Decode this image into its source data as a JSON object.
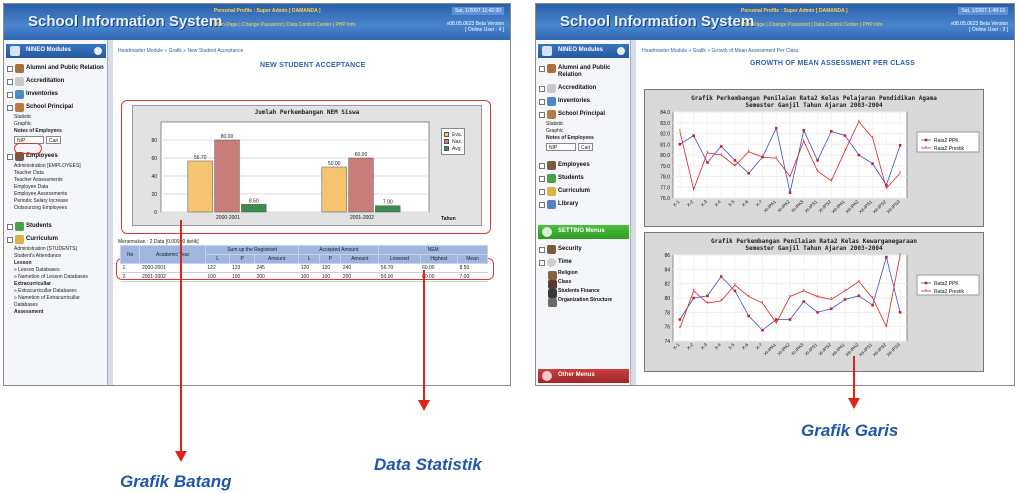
{
  "app": {
    "title": "School Information System",
    "profile": "Personal Profile : Super Admin [ DAMANDA ]",
    "links": "Main Page | Change Password | Data Control Center | PHP Info",
    "date1": "Sat, 1/2007 11:42:30",
    "date2": "Sat, 1/2007 1:49:16",
    "version": "v08.05.0623 Beta Version",
    "online": "[ Online User : 4 ]",
    "online2": "[ Online User : 3 ]"
  },
  "sidebar": {
    "modules_label": "NINEO Modules",
    "items1": [
      "Alumni and Public Relation",
      "Accreditation",
      "Inventories",
      "School Principal"
    ],
    "principal_sub": [
      "Statistic",
      "Graphic"
    ],
    "notes_label": "Notes of Employees",
    "search_value": "NIP",
    "search_btn": "Cari",
    "employees": "Employees",
    "employee_sub": [
      "Administration [EMPLOYEES]",
      "Teacher Data",
      "Teacher Assessments",
      "Employee Data",
      "Employee Assessments",
      "Periodic Salary Increase",
      "Outsourcing Employees"
    ],
    "students": "Students",
    "curriculum": "Curriculum",
    "curriculum_sub": [
      "Administration [STUDENTS]",
      "Student's Attendance",
      "Lesson",
      "» Lesson Databases",
      "» Nametion of Lesson Databases",
      "Extracurricullar",
      "» Extracurricullar Databases",
      "» Nametion of Extracurricullar Databases",
      "Assessment"
    ],
    "curriculum_bold": [
      "Lesson",
      "Extracurricullar",
      "Assessment"
    ],
    "library": "Library",
    "setting_label": "SETTING Menus",
    "setting_items": [
      "Security",
      "Time"
    ],
    "setting_sub": [
      "Religion",
      "Class",
      "Students Finance",
      "Organization Structure"
    ],
    "other_label": "Other Menus"
  },
  "left": {
    "breadcrumb": "Headmaster Module » Grafik » New Student Acceptance",
    "page_title": "NEW STUDENT ACCEPTANCE",
    "table_caption": "Menemukan : 2 Data [0,00990 detik]",
    "table_headers_top": [
      "No",
      "Academic Year",
      "Sum up the Registrant",
      "Accepted Amount",
      "NEM"
    ],
    "table_headers_sub": [
      "L",
      "P",
      "Amount",
      "L",
      "P",
      "Amount",
      "Lowered",
      "Highest",
      "Mean"
    ],
    "rows": [
      [
        "1.",
        "2000-2001",
        "122",
        "123",
        "245",
        "120",
        "120",
        "240",
        "56.70",
        "60.00",
        "8.50"
      ],
      [
        "2.",
        "2001-2002",
        "100",
        "100",
        "200",
        "100",
        "100",
        "200",
        "50.00",
        "60.00",
        "7.00"
      ]
    ]
  },
  "right": {
    "breadcrumb": "Headmaster Module » Grafik » Growth of Mean Assessment Per Class",
    "page_title": "GROWTH OF MEAN ASSESSMENT PER CLASS"
  },
  "captions": {
    "bar": "Grafik Batang",
    "stat": "Data Statistik",
    "line": "Grafik Garis"
  },
  "colors": {
    "eva": "#f5c470",
    "nax": "#c97d7b",
    "avg": "#3b8c4e",
    "blue": "#3a4fd6",
    "red": "#e02020"
  },
  "chart_data": [
    {
      "type": "bar",
      "title": "Jumlah Perkembangan NEM Siswa",
      "categories": [
        "2000-2001",
        "2001-2002"
      ],
      "xlabel": "Tahun",
      "ylim": [
        0,
        100
      ],
      "yticks": [
        "0",
        "20",
        "40",
        "60",
        "80"
      ],
      "series": [
        {
          "name": "Eva.",
          "values": [
            56.7,
            50.0
          ],
          "labels": [
            "56.70",
            "50.00"
          ]
        },
        {
          "name": "Nax.",
          "values": [
            80.0,
            60.0
          ],
          "labels": [
            "80.00",
            "60.00"
          ]
        },
        {
          "name": "Avg",
          "values": [
            8.5,
            7.0
          ],
          "labels": [
            "8.50",
            "7.00"
          ]
        }
      ]
    },
    {
      "type": "line",
      "title": "Grafik Perkembangan Penilaian Rata2 Kelas Pelajaran Pendidikan Agama",
      "subtitle": "Semester Ganjil Tahun Ajaran 2003-2004",
      "categories": [
        "X-1",
        "X-2",
        "X-3",
        "X-4",
        "X-5",
        "X-6",
        "X-7",
        "XI-IPA1",
        "XI-IPA2",
        "XI-IPA3",
        "XI-IPS1",
        "XI-IPS2",
        "XII-IPA1",
        "XII-IPA2",
        "XII-IPS1",
        "XII-IPS2",
        "XII-IPS3"
      ],
      "ylim": [
        76.0,
        84.0
      ],
      "yticks": [
        "76.0",
        "77.0",
        "78.0",
        "79.0",
        "80.0",
        "81.0",
        "82.0",
        "83.0",
        "84.0"
      ],
      "series": [
        {
          "name": "Rata2 PPK",
          "values": [
            81.0,
            81.8,
            79.3,
            80.8,
            79.5,
            78.3,
            79.8,
            82.5,
            76.5,
            82.3,
            79.5,
            82.2,
            81.8,
            80.0,
            79.2,
            77.2,
            80.9
          ]
        },
        {
          "name": "Rata2 Prestik",
          "values": [
            82.2,
            76.8,
            80.2,
            80.0,
            79.0,
            80.3,
            79.8,
            79.7,
            78.0,
            81.3,
            78.5,
            77.6,
            80.4,
            83.1,
            81.6,
            76.9,
            78.3
          ]
        }
      ]
    },
    {
      "type": "line",
      "title": "Grafik Perkembangan Penilaian Rata2 Kelas Kewarganegaraan",
      "subtitle": "Semester Ganjil Tahun Ajaran 2003-2004",
      "categories": [
        "X-1",
        "X-2",
        "X-3",
        "X-4",
        "X-5",
        "X-6",
        "X-7",
        "XI-IPA1",
        "XI-IPA2",
        "XI-IPA3",
        "XI-IPS1",
        "XI-IPS2",
        "XII-IPA1",
        "XII-IPA2",
        "XII-IPS1",
        "XII-IPS2",
        "XII-IPS3"
      ],
      "ylim": [
        74,
        86
      ],
      "yticks": [
        "74",
        "76",
        "78",
        "80",
        "82",
        "84",
        "86"
      ],
      "series": [
        {
          "name": "Rata2 PPK",
          "values": [
            77.0,
            80.0,
            80.3,
            83.0,
            81.0,
            77.5,
            75.5,
            77.0,
            77.0,
            79.5,
            78.0,
            78.5,
            79.8,
            80.3,
            79.0,
            85.7,
            78.0
          ]
        },
        {
          "name": "Rata2 Prestik",
          "values": [
            75.8,
            81.0,
            79.3,
            79.6,
            81.8,
            80.2,
            79.3,
            76.5,
            80.2,
            81.0,
            80.2,
            79.8,
            81.0,
            82.3,
            80.0,
            76.0,
            86.0
          ]
        }
      ]
    }
  ]
}
